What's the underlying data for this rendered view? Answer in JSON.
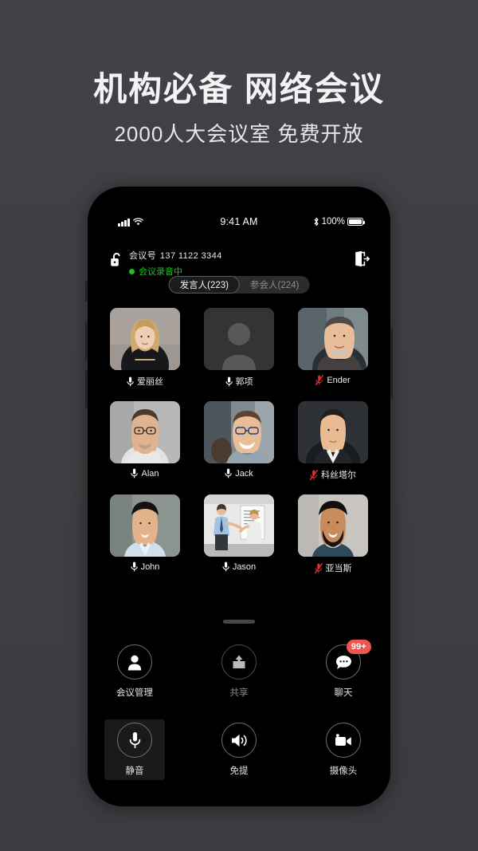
{
  "promo": {
    "headline": "机构必备 网络会议",
    "subheadline": "2000人大会议室 免费开放"
  },
  "colors": {
    "background": "#3d3f42",
    "screen": "#000000",
    "recording_green": "#18c718",
    "badge_red": "#f2554f",
    "mic_muted_red": "#d6342c",
    "accent_text": "#f2f3f4"
  },
  "statusbar": {
    "signal_icon": "signal-bars-icon",
    "wifi_icon": "wifi-icon",
    "time": "9:41 AM",
    "bluetooth_icon": "bluetooth-icon",
    "battery_percent": "100%",
    "battery_icon": "battery-full-icon"
  },
  "meeting": {
    "lock_icon": "unlock-icon",
    "id_label": "会议号",
    "id_value": "137 1122 3344",
    "recording_text": "会议录音中",
    "exit_icon": "exit-door-icon"
  },
  "tabs": [
    {
      "label": "发言人(223)",
      "active": true
    },
    {
      "label": "参会人(224)",
      "active": false
    }
  ],
  "participants": [
    {
      "name": "爱丽丝",
      "muted": false,
      "avatar": "woman-blonde",
      "mic_icon": "microphone-icon"
    },
    {
      "name": "郭项",
      "muted": false,
      "avatar": "placeholder",
      "mic_icon": "microphone-icon"
    },
    {
      "name": "Ender",
      "muted": true,
      "avatar": "man-beard-glasses",
      "mic_icon": "microphone-muted-icon"
    },
    {
      "name": "Alan",
      "muted": false,
      "avatar": "man-glasses",
      "mic_icon": "microphone-icon"
    },
    {
      "name": "Jack",
      "muted": false,
      "avatar": "man-blue-glasses",
      "mic_icon": "microphone-icon"
    },
    {
      "name": "科丝塔尔",
      "muted": true,
      "avatar": "man-suit",
      "mic_icon": "microphone-muted-icon"
    },
    {
      "name": "John",
      "muted": false,
      "avatar": "man-asian-shirt",
      "mic_icon": "microphone-icon"
    },
    {
      "name": "Jason",
      "muted": false,
      "avatar": "presentation-whiteboard",
      "mic_icon": "microphone-icon"
    },
    {
      "name": "亚当斯",
      "muted": true,
      "avatar": "man-beard-smile",
      "mic_icon": "microphone-muted-icon"
    }
  ],
  "controls": {
    "row1": [
      {
        "label": "会议管理",
        "icon": "person-icon",
        "dim": false,
        "selected": false,
        "badge": null
      },
      {
        "label": "共享",
        "icon": "share-upload-icon",
        "dim": true,
        "selected": false,
        "badge": null
      },
      {
        "label": "聊天",
        "icon": "chat-bubble-icon",
        "dim": false,
        "selected": false,
        "badge": "99+"
      }
    ],
    "row2": [
      {
        "label": "静音",
        "icon": "microphone-icon",
        "dim": false,
        "selected": true,
        "badge": null
      },
      {
        "label": "免提",
        "icon": "speaker-icon",
        "dim": false,
        "selected": false,
        "badge": null
      },
      {
        "label": "摄像头",
        "icon": "video-camera-icon",
        "dim": false,
        "selected": false,
        "badge": null
      }
    ]
  }
}
